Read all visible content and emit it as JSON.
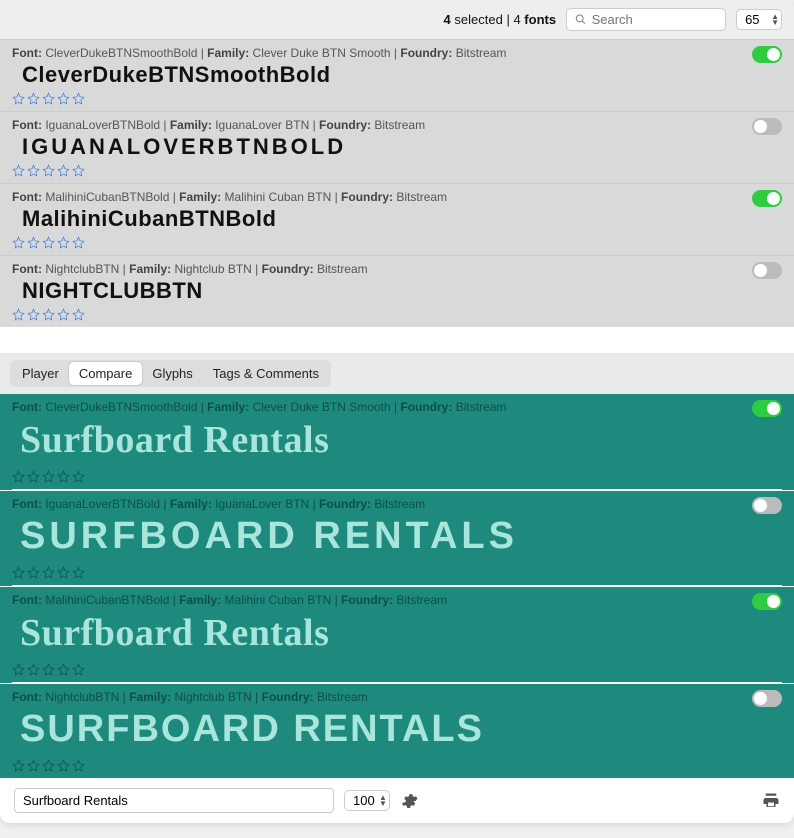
{
  "header": {
    "selected_count": "4",
    "selected_word": "selected",
    "separator": " | ",
    "fonts_count": "4",
    "fonts_word": "fonts",
    "search_placeholder": "Search",
    "size_value": "65"
  },
  "labels": {
    "font": "Font:",
    "family": "Family:",
    "foundry": "Foundry:"
  },
  "fonts": [
    {
      "name": "CleverDukeBTNSmoothBold",
      "family": "Clever Duke BTN Smooth",
      "foundry": "Bitstream",
      "enabled": true,
      "sample": "CleverDukeBTNSmoothBold"
    },
    {
      "name": "IguanaLoverBTNBold",
      "family": "IguanaLover BTN",
      "foundry": "Bitstream",
      "enabled": false,
      "sample": "IGUANALOVERBTNBOLD"
    },
    {
      "name": "MalihiniCubanBTNBold",
      "family": "Malihini Cuban BTN",
      "foundry": "Bitstream",
      "enabled": true,
      "sample": "MalihiniCubanBTNBold"
    },
    {
      "name": "NightclubBTN",
      "family": "Nightclub BTN",
      "foundry": "Bitstream",
      "enabled": false,
      "sample": "NIGHTCLUBBTN"
    }
  ],
  "tabs": {
    "items": [
      "Player",
      "Compare",
      "Glyphs",
      "Tags & Comments"
    ],
    "active_index": 1
  },
  "compare": {
    "sample_text": "Surfboard Rentals",
    "fonts": [
      {
        "name": "CleverDukeBTNSmoothBold",
        "family": "Clever Duke BTN Smooth",
        "foundry": "Bitstream",
        "enabled": true
      },
      {
        "name": "IguanaLoverBTNBold",
        "family": "IguanaLover BTN",
        "foundry": "Bitstream",
        "enabled": false
      },
      {
        "name": "MalihiniCubanBTNBold",
        "family": "Malihini Cuban BTN",
        "foundry": "Bitstream",
        "enabled": true
      },
      {
        "name": "NightclubBTN",
        "family": "Nightclub BTN",
        "foundry": "Bitstream",
        "enabled": false
      }
    ]
  },
  "bottom": {
    "text_value": "Surfboard Rentals",
    "size_value": "100"
  }
}
